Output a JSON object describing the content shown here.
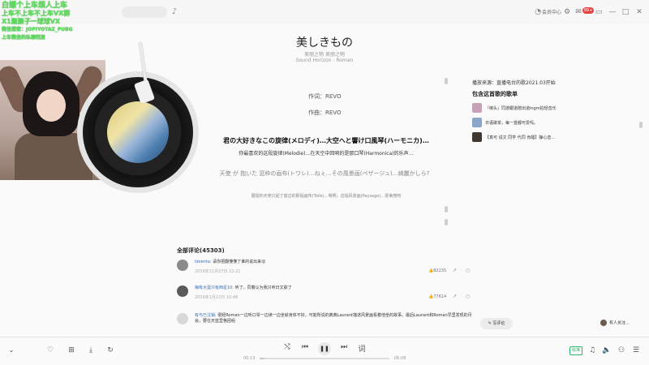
{
  "overlay": {
    "line1": "白嫖个上车烦人上车",
    "line2": "上车不上车不上车VX群",
    "line3": "X1聚聚子一球球VX",
    "line4": "微信搜索：JOPIYOTAZ_PUBG",
    "line5": "上车微信的私聊回复"
  },
  "titlebar": {
    "icons": [
      "mic-icon",
      "cloud-icon",
      "settings-icon",
      "mail-icon",
      "minimize-icon",
      "restore-icon",
      "close-icon"
    ],
    "login_text": "会员中心",
    "badge": "99+"
  },
  "song": {
    "title": "美しきもの",
    "subtitle": "美丽之物 美丽之物",
    "artist": "Sound Horizon - Roman"
  },
  "lyrics": {
    "credit1": "作词：REVO",
    "credit2": "作曲：REVO",
    "main": "君の大好きなこの旋律(メロディ)…大空へと響け口風琴(ハーモニカ)…",
    "main_trans": "你最喜欢的这段旋律(Melodie)…在天空中回响的是那口琴(Harmonica)的乐声…",
    "next": "天使 が 抱いた 窓枠の画布(トワレ)…ねぇ…その風景画(ペザージュ)…綺麗かしら?",
    "next_trans": "展翅的天使只起了窗边的那幅画布(Toile)…喂啊，这幅风景画(Paysage)…很美丽吧"
  },
  "sidebar": {
    "heading": "播放来源：直播电台的歌2021.03开始",
    "playlists_title": "包含这首歌的歌单",
    "playlists": [
      {
        "text": "『绑头』同游跟道陪出道ingm拍轻音乐",
        "color": "#c8a0b8"
      },
      {
        "text": "日语歌单，每一首都可爱吗。",
        "color": "#8aa6c8"
      },
      {
        "text": "【真可 说文 同学 代同 肯醒】静心音…",
        "color": "#40382f"
      }
    ]
  },
  "comments": {
    "title": "全部评论(45303)",
    "items": [
      {
        "user": "Idventa:",
        "text": "请你把翻懂懂了谁的说出来😮",
        "time": "2019年11月27日 22:21",
        "likes": "82235",
        "avatar": "#8a8a8a"
      },
      {
        "user": "梅有大蛋只有西星10:",
        "text": "听了。同着认为我只听日文歌了",
        "time": "2019年1月22日 10:46",
        "likes": "77614",
        "avatar": "#5a5a5a"
      },
      {
        "user": "有与已注销:",
        "text": "很经Roman一边听口琴一边读一边坐就身体不好，可能所说的典典Laurant描述风景画看着他坐的故事。最后Laurant和Roman早里发现的月会，要在天蓝里格团组",
        "time": "",
        "likes": "",
        "avatar": "#d8d8d8"
      }
    ]
  },
  "write_comment": "写评论",
  "people_listening": "有人关注…",
  "player": {
    "current_time": "00:13",
    "total_time": "06:08",
    "progress": 0.035,
    "lyric_toggle": "词",
    "quality": "标准"
  },
  "colors": {
    "overlay_green": "#5be35b",
    "badge_red": "#e64545",
    "link_blue": "#3a6fb0",
    "quality_green": "#2db36b"
  }
}
